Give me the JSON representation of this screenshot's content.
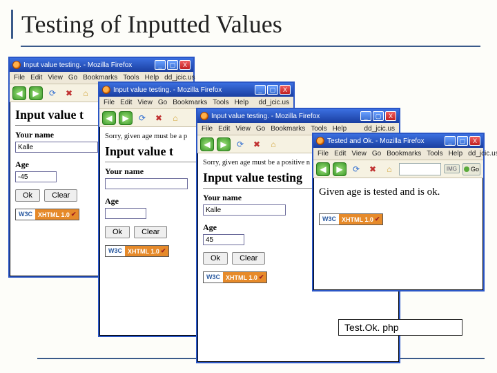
{
  "slide": {
    "title": "Testing of Inputted Values",
    "caption": "Test.Ok. php"
  },
  "menus": {
    "file": "File",
    "edit": "Edit",
    "view": "View",
    "go": "Go",
    "bookmarks": "Bookmarks",
    "tools": "Tools",
    "help": "Help",
    "url": "dd_jcic.us"
  },
  "win_input": {
    "title": "Input value testing. - Mozilla Firefox"
  },
  "win_ok": {
    "title": "Tested and Ok. - Mozilla Firefox"
  },
  "page": {
    "heading_input": "Input value testing",
    "heading_input_trunc": "Input value t",
    "heading_ok": "Given age is tested and is ok.",
    "error_short": "Sorry, given age must be a p",
    "error_long": "Sorry, given age must be a positive n",
    "lbl_name": "Your name",
    "lbl_age": "Age",
    "val_name1": "Kalle",
    "val_age1": "-45",
    "val_name2": "",
    "val_age2": "",
    "val_name3": "Kalle",
    "val_age3": "45",
    "btn_ok": "Ok",
    "btn_clear": "Clear"
  },
  "w3c": {
    "left": "W3C",
    "right": "XHTML 1.0",
    "check": "✔"
  },
  "go": {
    "label": "Go"
  },
  "toolbar": {
    "img_pill": "IMG"
  }
}
